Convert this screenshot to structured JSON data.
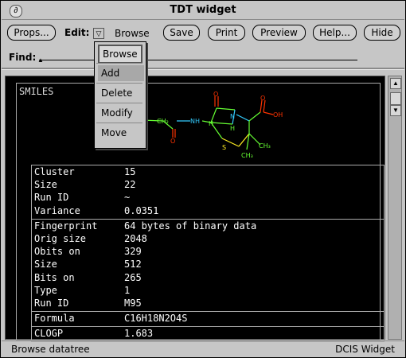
{
  "window": {
    "title": "TDT widget",
    "menu_glyph": "∂"
  },
  "toolbar": {
    "props": "Props...",
    "edit_label": "Edit:",
    "edit_value": "Browse",
    "save": "Save",
    "print": "Print",
    "preview": "Preview",
    "help": "Help...",
    "hide": "Hide"
  },
  "find": {
    "label": "Find:",
    "value": ""
  },
  "edit_menu": {
    "items": [
      "Browse",
      "Add",
      "Delete",
      "Modify",
      "Move"
    ]
  },
  "viewer": {
    "smiles_label": "SMILES",
    "structure_labels": {
      "ch2": "CH₂",
      "nh": "NH",
      "o1": "O",
      "o2": "O",
      "o3": "O",
      "oh": "OH",
      "n": "N",
      "h1": "H",
      "h2": "H",
      "s": "S",
      "ch3a": "CH₃",
      "ch3b": "CH₃"
    },
    "groups": [
      [
        {
          "k": "Cluster",
          "v": "15"
        },
        {
          "k": "Size",
          "v": "22"
        },
        {
          "k": "Run ID",
          "v": "~"
        },
        {
          "k": "Variance",
          "v": "0.0351"
        }
      ],
      [
        {
          "k": "Fingerprint",
          "v": "64 bytes of binary data"
        },
        {
          "k": "Orig size",
          "v": "2048"
        },
        {
          "k": "Obits on",
          "v": "329"
        },
        {
          "k": "Size",
          "v": "512"
        },
        {
          "k": "Bits on",
          "v": "265"
        },
        {
          "k": "Type",
          "v": "1"
        },
        {
          "k": "Run ID",
          "v": "M95"
        }
      ],
      [
        {
          "k": "Formula",
          "v": "C16H18N2O4S"
        }
      ],
      [
        {
          "k": "CLOGP",
          "v": "1.683"
        }
      ]
    ]
  },
  "status": {
    "left": "Browse datatree",
    "right": "DCIS Widget"
  },
  "colors": {
    "green": "#66ff33",
    "red": "#ff3300",
    "cyan": "#33ccff",
    "yellow": "#ffee22"
  }
}
